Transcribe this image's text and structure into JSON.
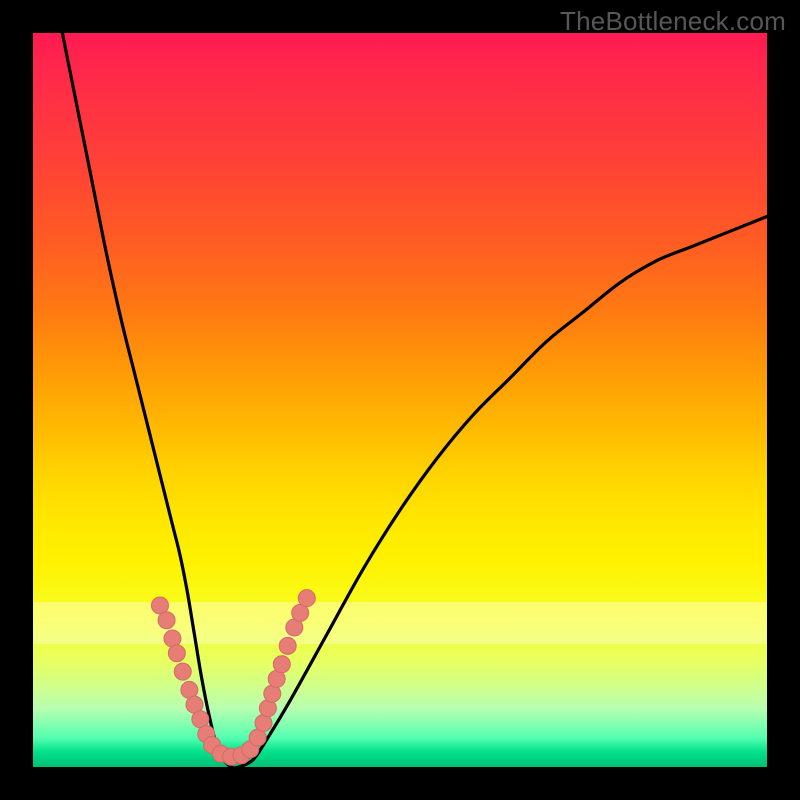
{
  "watermark": "TheBottleneck.com",
  "colors": {
    "frame": "#000000",
    "curve": "#000000",
    "marker_fill": "#e77d77",
    "marker_stroke": "#d46a66"
  },
  "chart_data": {
    "type": "line",
    "title": "",
    "xlabel": "",
    "ylabel": "",
    "xlim": [
      0,
      100
    ],
    "ylim": [
      0,
      100
    ],
    "grid": false,
    "series": [
      {
        "name": "bottleneck-curve",
        "x": [
          4,
          6,
          8,
          10,
          12,
          14,
          16,
          17,
          18,
          19,
          20,
          21,
          22,
          23,
          24,
          25,
          26,
          27,
          28,
          30,
          32,
          35,
          40,
          45,
          50,
          55,
          60,
          65,
          70,
          75,
          80,
          85,
          90,
          95,
          100
        ],
        "y": [
          100,
          90,
          80,
          70,
          61,
          53,
          45,
          41,
          37,
          33,
          29,
          24,
          18,
          12,
          7,
          3,
          1,
          0,
          0,
          1,
          4,
          9,
          18,
          27,
          35,
          42,
          48,
          53,
          58,
          62,
          66,
          69,
          71,
          73,
          75
        ]
      }
    ],
    "markers": {
      "name": "highlight-dots",
      "points": [
        {
          "x": 17.3,
          "y": 22.0
        },
        {
          "x": 18.2,
          "y": 20.0
        },
        {
          "x": 19.0,
          "y": 17.5
        },
        {
          "x": 19.6,
          "y": 15.5
        },
        {
          "x": 20.4,
          "y": 13.0
        },
        {
          "x": 21.3,
          "y": 10.5
        },
        {
          "x": 22.0,
          "y": 8.5
        },
        {
          "x": 22.8,
          "y": 6.5
        },
        {
          "x": 23.6,
          "y": 4.5
        },
        {
          "x": 24.4,
          "y": 3.0
        },
        {
          "x": 25.6,
          "y": 1.8
        },
        {
          "x": 27.0,
          "y": 1.4
        },
        {
          "x": 28.4,
          "y": 1.6
        },
        {
          "x": 29.6,
          "y": 2.4
        },
        {
          "x": 30.6,
          "y": 4.0
        },
        {
          "x": 31.4,
          "y": 6.0
        },
        {
          "x": 32.0,
          "y": 8.0
        },
        {
          "x": 32.6,
          "y": 10.0
        },
        {
          "x": 33.2,
          "y": 12.0
        },
        {
          "x": 33.9,
          "y": 14.0
        },
        {
          "x": 34.7,
          "y": 16.5
        },
        {
          "x": 35.6,
          "y": 19.0
        },
        {
          "x": 36.4,
          "y": 21.0
        },
        {
          "x": 37.3,
          "y": 23.0
        }
      ]
    }
  }
}
